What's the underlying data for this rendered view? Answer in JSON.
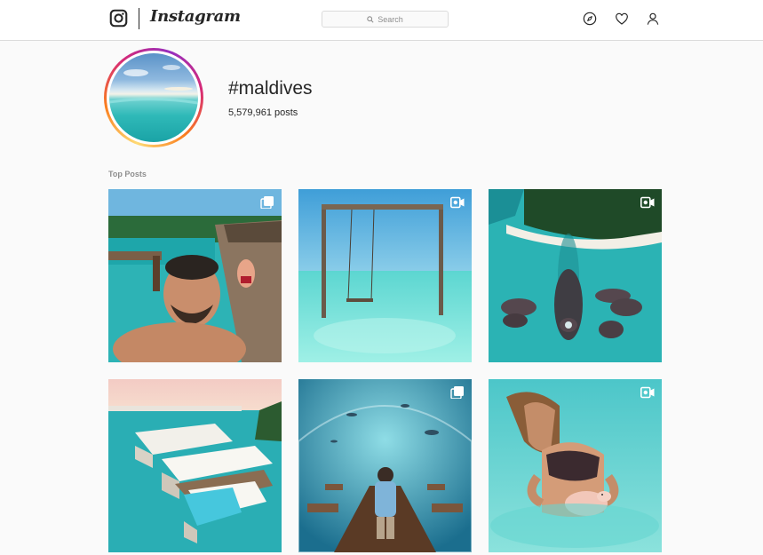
{
  "nav": {
    "brand": "Instagram",
    "search_placeholder": "Search",
    "icons": [
      "camera-logo-icon",
      "search-icon",
      "compass-icon",
      "heart-icon",
      "profile-icon"
    ]
  },
  "header": {
    "hashtag": "#maldives",
    "post_count": "5,579,961 posts"
  },
  "section": {
    "label": "Top Posts"
  },
  "posts": [
    {
      "badge": "multiple-photos-icon",
      "subject": "selfie-on-pier"
    },
    {
      "badge": "video-icon",
      "subject": "swing-in-lagoon"
    },
    {
      "badge": "video-icon",
      "subject": "aerial-overwater-villas"
    },
    {
      "badge": "none",
      "subject": "overwater-villa-pool"
    },
    {
      "badge": "multiple-photos-icon",
      "subject": "underwater-restaurant"
    },
    {
      "badge": "video-icon",
      "subject": "woman-with-piglet"
    }
  ],
  "colors": {
    "accent_gradient": [
      "#feda75",
      "#fa7e1e",
      "#d62976",
      "#962fbf"
    ],
    "text": "#262626",
    "muted": "#8e8e8e",
    "border": "#dbdbdb"
  }
}
